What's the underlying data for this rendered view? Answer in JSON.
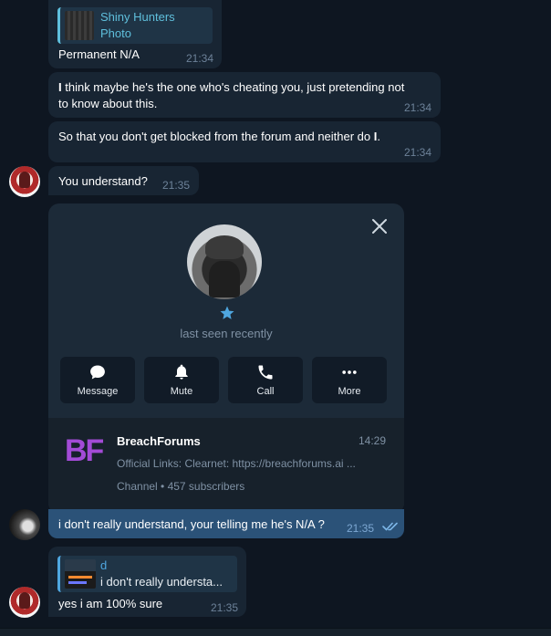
{
  "messages": {
    "m1": {
      "reply_name": "Shiny Hunters",
      "reply_text": "Photo",
      "text": "Permanent N/A",
      "time": "21:34"
    },
    "m2": {
      "line1_bold": "I",
      "line1": " think maybe he's the one who's cheating you, just pretending not",
      "line2": "to know about this.",
      "time": "21:34"
    },
    "m3": {
      "text": "So that you don't get blocked from the forum and neither do ",
      "bold": "I",
      "end": ".",
      "time": "21:34"
    },
    "m4": {
      "text": "You understand?",
      "time": "21:35"
    },
    "m5": {
      "text": "i don't really understand, your telling me he's N/A ?",
      "time": "21:35"
    },
    "m6": {
      "reply_name": "d",
      "reply_text": "i don't really understa...",
      "text": "yes i am 100% sure",
      "time": "21:35"
    }
  },
  "profile_card": {
    "status": "last seen recently",
    "actions": [
      {
        "label": "Message",
        "icon": "message-icon"
      },
      {
        "label": "Mute",
        "icon": "bell-icon"
      },
      {
        "label": "Call",
        "icon": "phone-icon"
      },
      {
        "label": "More",
        "icon": "more-icon"
      }
    ],
    "channel": {
      "logo": "BF",
      "name": "BreachForums",
      "time": "14:29",
      "preview": "Official Links: Clearnet: https://breachforums.ai ...",
      "meta": "Channel • 457 subscribers"
    }
  },
  "colors": {
    "background": "#0e1621",
    "incoming_bubble": "#182533",
    "outgoing_bubble": "#2b5278",
    "accent": "#4fa7e0"
  }
}
